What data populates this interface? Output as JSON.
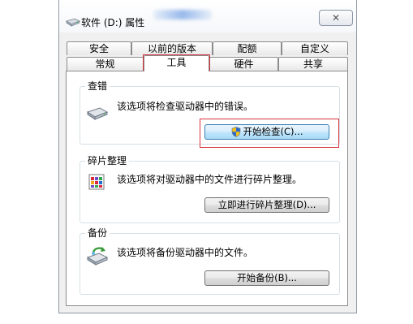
{
  "window": {
    "title": "软件 (D:) 属性",
    "close_label": "✕"
  },
  "tabs": {
    "row_back": [
      "安全",
      "以前的版本",
      "配额",
      "自定义"
    ],
    "row_front": [
      "常规",
      "工具",
      "硬件",
      "共享"
    ],
    "active": "工具"
  },
  "groups": {
    "check": {
      "title": "查错",
      "description": "该选项将检查驱动器中的错误。",
      "button_label": "开始检查(C)..."
    },
    "defrag": {
      "title": "碎片整理",
      "description": "该选项将对驱动器中的文件进行碎片整理。",
      "button_label": "立即进行碎片整理(D)..."
    },
    "backup": {
      "title": "备份",
      "description": "该选项将备份驱动器中的文件。",
      "button_label": "开始备份(B)..."
    }
  },
  "colors": {
    "highlight_box": "#d5333b",
    "focus_button": "#bee6fd"
  }
}
